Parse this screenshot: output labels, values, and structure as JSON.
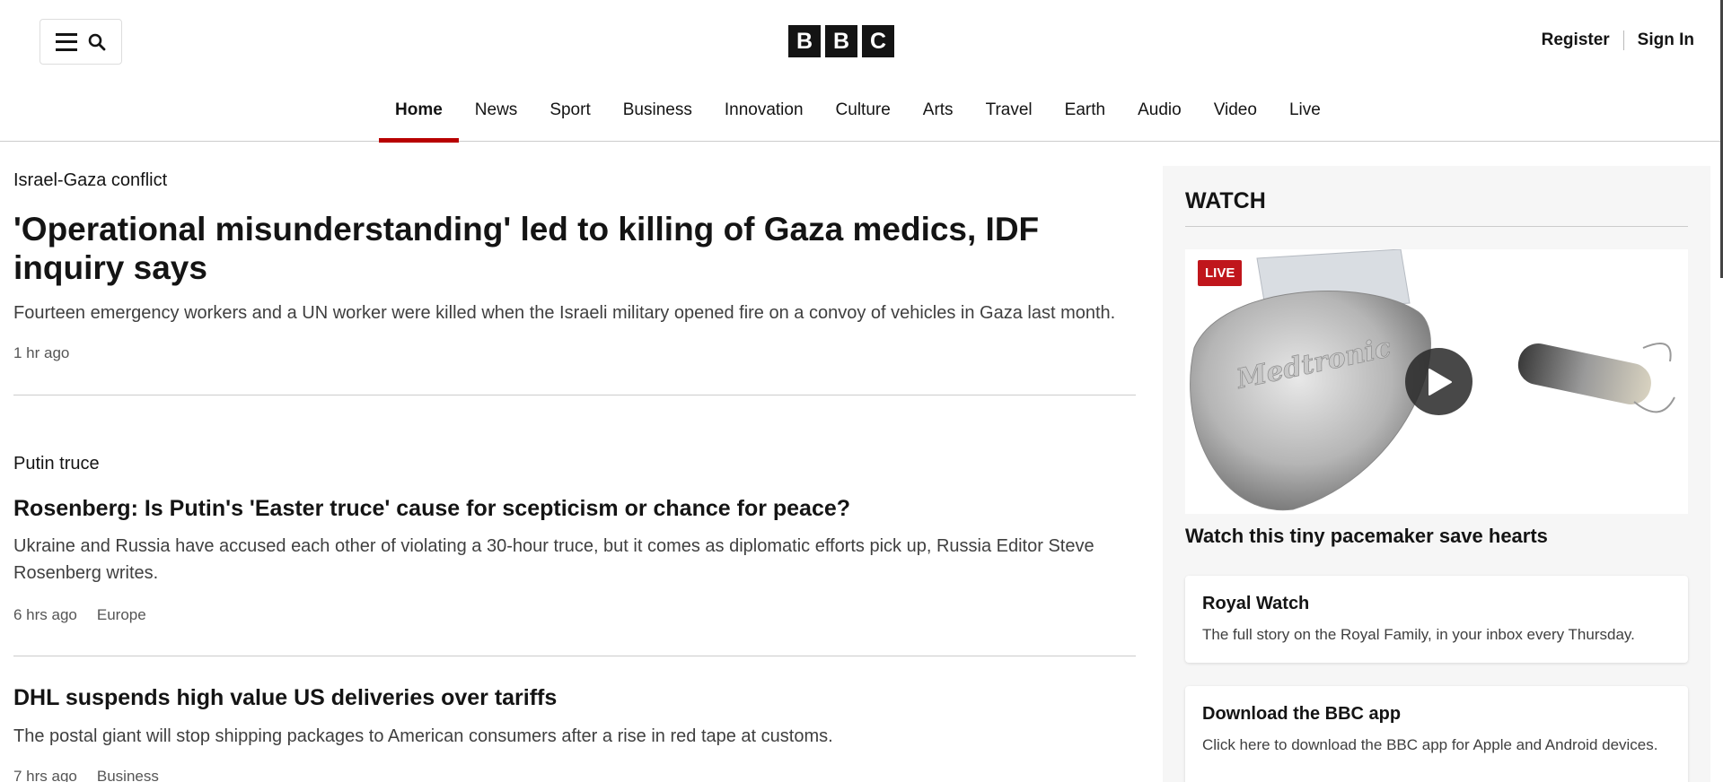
{
  "header": {
    "logo_letters": [
      "B",
      "B",
      "C"
    ],
    "register_label": "Register",
    "signin_label": "Sign In"
  },
  "nav": {
    "items": [
      "Home",
      "News",
      "Sport",
      "Business",
      "Innovation",
      "Culture",
      "Arts",
      "Travel",
      "Earth",
      "Audio",
      "Video",
      "Live"
    ],
    "active": "Home",
    "accent_color": "#b80000"
  },
  "stories": [
    {
      "category": "Israel-Gaza conflict",
      "headline": "'Operational misunderstanding' led to killing of Gaza medics, IDF inquiry says",
      "summary": "Fourteen emergency workers and a UN worker were killed when the Israeli military opened fire on a convoy of vehicles in Gaza last month.",
      "time": "1 hr ago"
    },
    {
      "category": "Putin truce",
      "headline": "Rosenberg: Is Putin's 'Easter truce' cause for scepticism or chance for peace?",
      "summary": "Ukraine and Russia have accused each other of violating a 30-hour truce, but it comes as diplomatic efforts pick up, Russia Editor Steve Rosenberg writes.",
      "time": "6 hrs ago",
      "section": "Europe"
    },
    {
      "headline": "DHL suspends high value US deliveries over tariffs",
      "summary": "The postal giant will stop shipping packages to American consumers after a rise in red tape at customs.",
      "time": "7 hrs ago",
      "section": "Business"
    }
  ],
  "sidebar": {
    "watch_title": "WATCH",
    "live_badge": "LIVE",
    "video_title": "Watch this tiny pacemaker save hearts",
    "video_brand_text": "Medtronic",
    "cards": [
      {
        "title": "Royal Watch",
        "text": "The full story on the Royal Family, in your inbox every Thursday."
      },
      {
        "title": "Download the BBC app",
        "text": "Click here to download the BBC app for Apple and Android devices."
      }
    ]
  }
}
